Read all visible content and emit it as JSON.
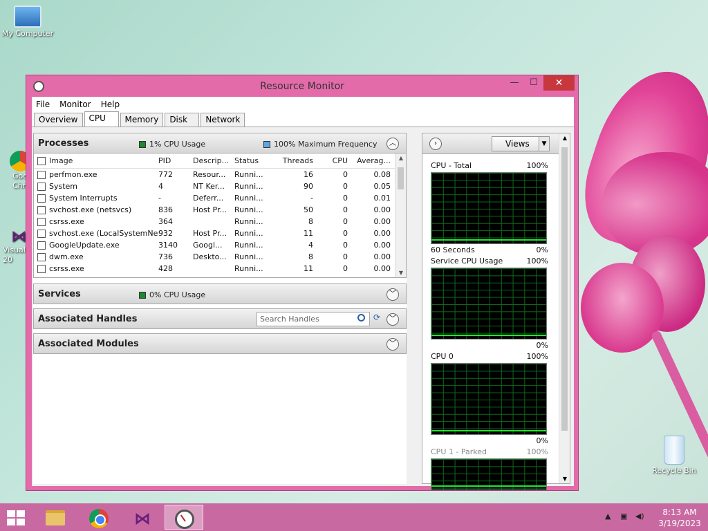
{
  "desktop": {
    "icons": {
      "my_computer": "My Computer",
      "recycle_bin": "Recycle Bin",
      "chrome_partial": "Goo\nChr",
      "vs_partial": "Visual\n20"
    }
  },
  "window": {
    "title": "Resource Monitor",
    "controls": {
      "minimize": "—",
      "maximize": "☐",
      "close": "✕"
    }
  },
  "menu": {
    "file": "File",
    "monitor": "Monitor",
    "help": "Help"
  },
  "tabs": [
    "Overview",
    "CPU",
    "Memory",
    "Disk",
    "Network"
  ],
  "active_tab": "CPU",
  "processes": {
    "title": "Processes",
    "cpu_usage": "1% CPU Usage",
    "max_freq": "100% Maximum Frequency",
    "columns": {
      "image": "Image",
      "pid": "PID",
      "desc": "Descrip...",
      "status": "Status",
      "threads": "Threads",
      "cpu": "CPU",
      "avg": "Averag..."
    },
    "rows": [
      {
        "image": "perfmon.exe",
        "pid": "772",
        "desc": "Resour...",
        "status": "Runni...",
        "threads": "16",
        "cpu": "0",
        "avg": "0.08"
      },
      {
        "image": "System",
        "pid": "4",
        "desc": "NT Ker...",
        "status": "Runni...",
        "threads": "90",
        "cpu": "0",
        "avg": "0.05"
      },
      {
        "image": "System Interrupts",
        "pid": "-",
        "desc": "Deferr...",
        "status": "Runni...",
        "threads": "-",
        "cpu": "0",
        "avg": "0.01"
      },
      {
        "image": "svchost.exe (netsvcs)",
        "pid": "836",
        "desc": "Host Pr...",
        "status": "Runni...",
        "threads": "50",
        "cpu": "0",
        "avg": "0.00"
      },
      {
        "image": "csrss.exe",
        "pid": "364",
        "desc": "",
        "status": "Runni...",
        "threads": "8",
        "cpu": "0",
        "avg": "0.00"
      },
      {
        "image": "svchost.exe (LocalSystemNet...",
        "pid": "932",
        "desc": "Host Pr...",
        "status": "Runni...",
        "threads": "11",
        "cpu": "0",
        "avg": "0.00"
      },
      {
        "image": "GoogleUpdate.exe",
        "pid": "3140",
        "desc": "Googl...",
        "status": "Runni...",
        "threads": "4",
        "cpu": "0",
        "avg": "0.00"
      },
      {
        "image": "dwm.exe",
        "pid": "736",
        "desc": "Deskto...",
        "status": "Runni...",
        "threads": "8",
        "cpu": "0",
        "avg": "0.00"
      },
      {
        "image": "csrss.exe",
        "pid": "428",
        "desc": "",
        "status": "Runni...",
        "threads": "11",
        "cpu": "0",
        "avg": "0.00"
      }
    ]
  },
  "services": {
    "title": "Services",
    "cpu_usage": "0% CPU Usage"
  },
  "handles": {
    "title": "Associated Handles",
    "search_placeholder": "Search Handles"
  },
  "modules": {
    "title": "Associated Modules"
  },
  "graphs_panel": {
    "views_label": "Views",
    "graphs": [
      {
        "title": "CPU - Total",
        "max": "100%",
        "foot_left": "60 Seconds",
        "foot_right": "0%"
      },
      {
        "title": "Service CPU Usage",
        "max": "100%",
        "foot_left": "",
        "foot_right": "0%"
      },
      {
        "title": "CPU 0",
        "max": "100%",
        "foot_left": "",
        "foot_right": "0%"
      },
      {
        "title": "CPU 1 - Parked",
        "max": "100%",
        "foot_left": "",
        "foot_right": ""
      }
    ]
  },
  "taskbar": {
    "time": "8:13 AM",
    "date": "3/19/2023"
  },
  "colors": {
    "accent": "#e36ba9",
    "graph_line": "#21e62f",
    "close": "#c7373d"
  }
}
